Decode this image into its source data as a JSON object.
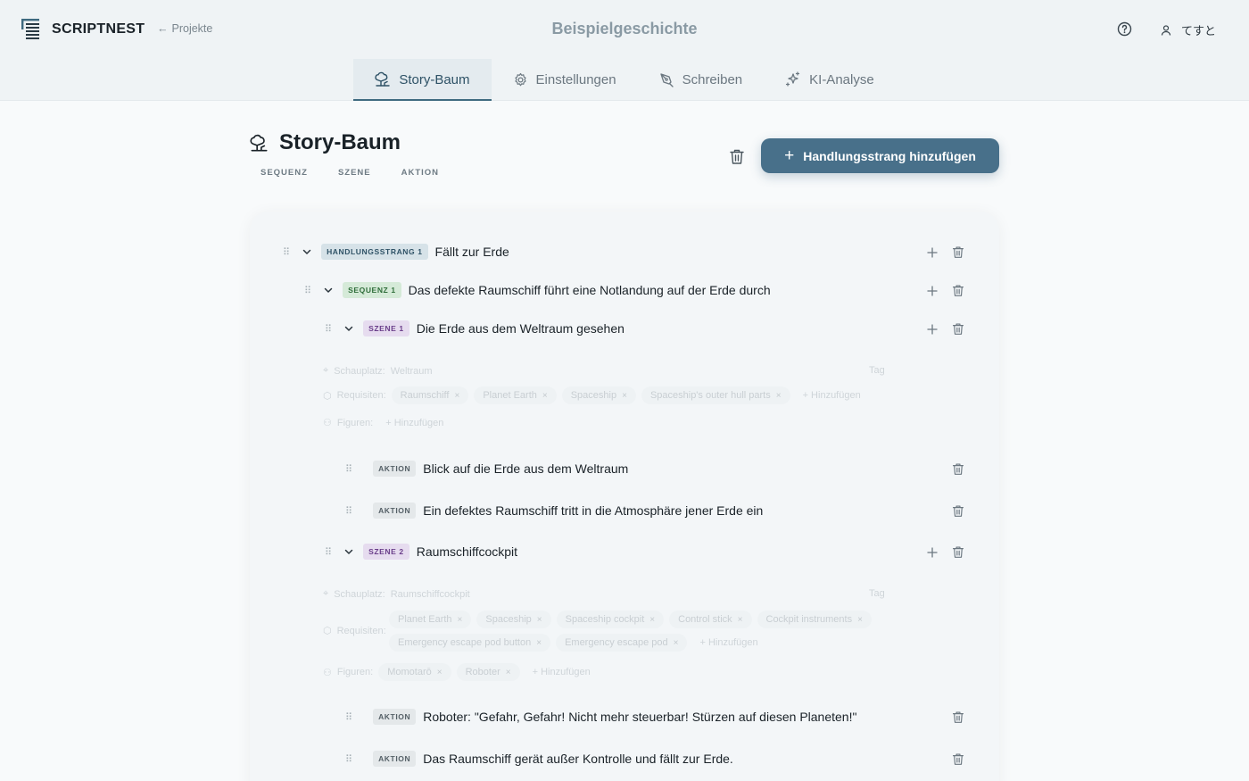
{
  "app": {
    "name": "SCRIPTNEST",
    "back_label": "Projekte",
    "project_title": "Beispielgeschichte",
    "user_name": "てすと"
  },
  "tabs": [
    {
      "label": "Story-Baum",
      "icon": "tree-icon",
      "active": true
    },
    {
      "label": "Einstellungen",
      "icon": "gear-icon",
      "active": false
    },
    {
      "label": "Schreiben",
      "icon": "pen-icon",
      "active": false
    },
    {
      "label": "KI-Analyse",
      "icon": "sparkles-icon",
      "active": false
    }
  ],
  "page": {
    "title": "Story-Baum",
    "sub_tabs": [
      "SEQUENZ",
      "SZENE",
      "AKTION"
    ],
    "add_strand_label": "Handlungsstrang hinzufügen"
  },
  "tree": {
    "strand": {
      "badge": "HANDLUNGSSTRANG 1",
      "label": "Fällt zur Erde"
    },
    "sequence": {
      "badge": "SEQUENZ 1",
      "label": "Das defekte Raumschiff führt eine Notlandung auf der Erde durch"
    },
    "scenes": [
      {
        "badge": "SZENE 1",
        "label": "Die Erde aus dem Weltraum gesehen",
        "location_label": "Schauplatz:",
        "location": "Weltraum",
        "time_label": "Tag",
        "props_label": "Requisiten:",
        "props": [
          "Raumschiff",
          "Planet Earth",
          "Spaceship",
          "Spaceship's outer hull parts"
        ],
        "figures_label": "Figuren:",
        "figures": [],
        "add_label": "+ Hinzufügen",
        "actions": [
          {
            "badge": "AKTION",
            "label": "Blick auf die Erde aus dem Weltraum"
          },
          {
            "badge": "AKTION",
            "label": "Ein defektes Raumschiff tritt in die Atmosphäre jener Erde ein"
          }
        ]
      },
      {
        "badge": "SZENE 2",
        "label": "Raumschiffcockpit",
        "location_label": "Schauplatz:",
        "location": "Raumschiffcockpit",
        "time_label": "Tag",
        "props_label": "Requisiten:",
        "props_row1": [
          "Planet Earth",
          "Spaceship",
          "Spaceship cockpit",
          "Control stick",
          "Cockpit instruments"
        ],
        "props_row2": [
          "Emergency escape pod button",
          "Emergency escape pod"
        ],
        "figures_label": "Figuren:",
        "figures": [
          "Momotarō",
          "Roboter"
        ],
        "add_label": "+ Hinzufügen",
        "actions": [
          {
            "badge": "AKTION",
            "label": "Roboter: \"Gefahr, Gefahr! Nicht mehr steuerbar! Stürzen auf diesen Planeten!\""
          },
          {
            "badge": "AKTION",
            "label": "Das Raumschiff gerät außer Kontrolle und fällt zur Erde."
          }
        ]
      }
    ]
  },
  "colors": {
    "accent": "#48708a",
    "header_bg": "#eff3f5",
    "strand_badge": "#d6e2e8",
    "sequence_badge": "#d5ead8",
    "scene_badge": "#e6dcef"
  }
}
